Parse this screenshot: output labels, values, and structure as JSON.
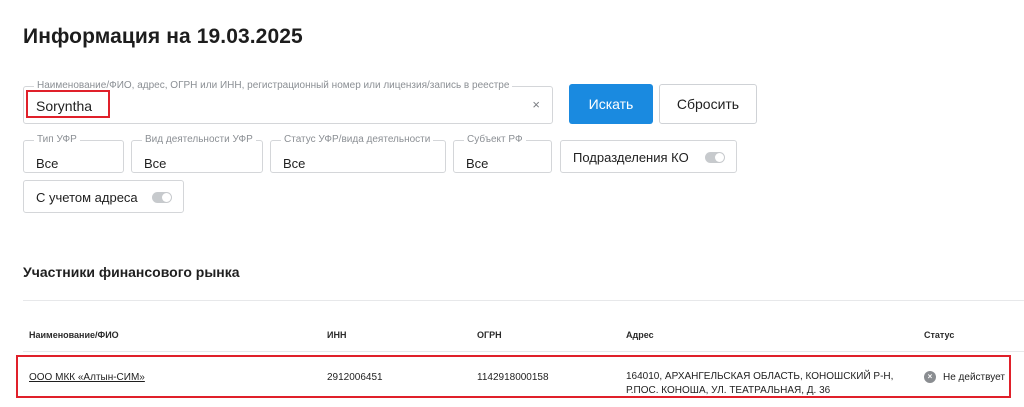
{
  "page_title": "Информация на 19.03.2025",
  "search": {
    "legend": "Наименование/ФИО, адрес, ОГРН или ИНН, регистрационный номер или лицензия/запись в реестре",
    "value": "Sorynthа",
    "clear_symbol": "×",
    "submit_label": "Искать",
    "reset_label": "Сбросить"
  },
  "filters": [
    {
      "legend": "Тип УФР",
      "value": "Все"
    },
    {
      "legend": "Вид деятельности УФР",
      "value": "Все"
    },
    {
      "legend": "Статус УФР/вида деятельности",
      "value": "Все"
    },
    {
      "legend": "Субъект РФ",
      "value": "Все"
    }
  ],
  "toggles": {
    "divisions": {
      "label": "Подразделения КО",
      "on": false
    },
    "address": {
      "label": "С учетом адреса",
      "on": false
    }
  },
  "section_title": "Участники финансового рынка",
  "table": {
    "columns": [
      "Наименование/ФИО",
      "ИНН",
      "ОГРН",
      "Адрес",
      "Статус"
    ],
    "rows": [
      {
        "name": "ООО МКК «Алтын-СИМ»",
        "inn": "2912006451",
        "ogrn": "1142918000158",
        "address_line1": "164010, АРХАНГЕЛЬСКАЯ ОБЛАСТЬ, КОНОШСКИЙ Р-Н,",
        "address_line2": "Р.ПОС. КОНОША, УЛ. ТЕАТРАЛЬНАЯ, Д. 36",
        "status": "Не действует",
        "status_icon": "close-circle-icon"
      }
    ]
  },
  "colors": {
    "primary": "#1a8ae0",
    "highlight": "#e0202a"
  }
}
